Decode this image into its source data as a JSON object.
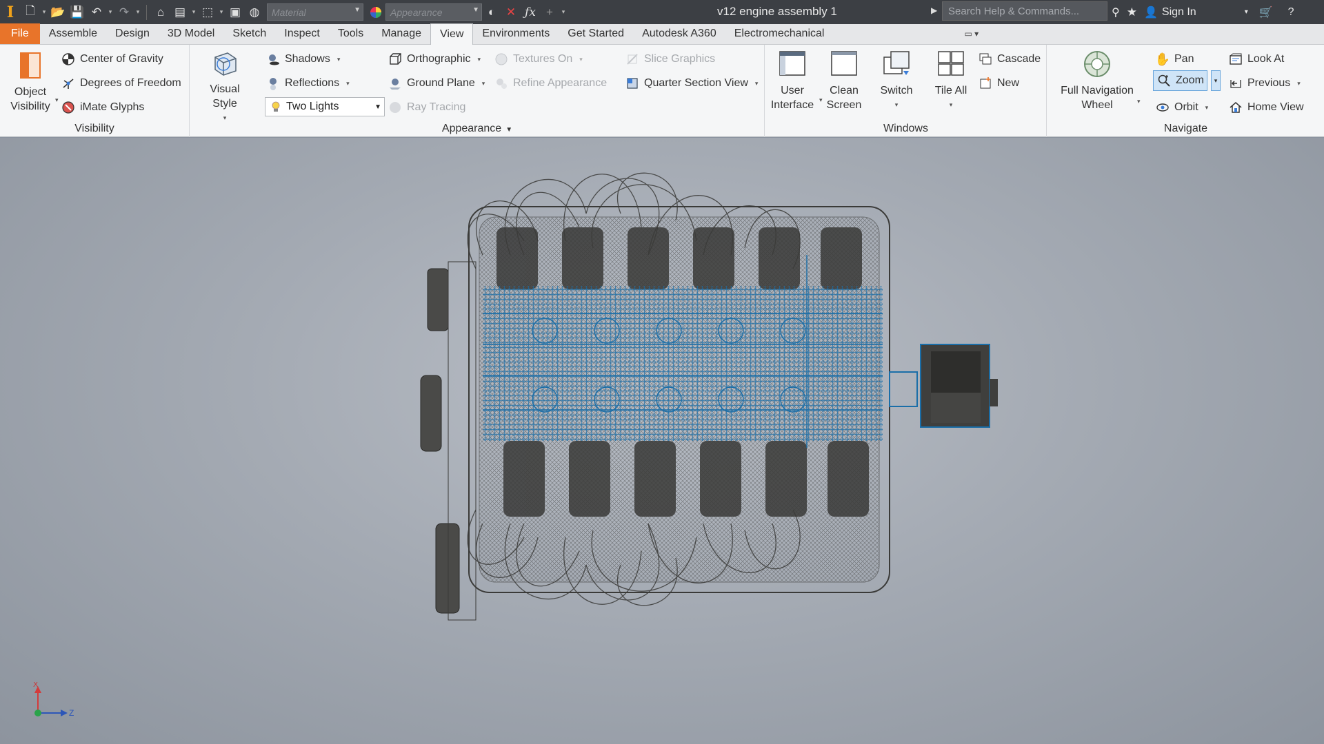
{
  "titlebar": {
    "doc_title": "v12 engine assembly 1",
    "material_placeholder": "Material",
    "appearance_placeholder": "Appearance",
    "search_placeholder": "Search Help & Commands...",
    "sign_in": "Sign In"
  },
  "tabs": [
    {
      "label": "File"
    },
    {
      "label": "Assemble"
    },
    {
      "label": "Design"
    },
    {
      "label": "3D Model"
    },
    {
      "label": "Sketch"
    },
    {
      "label": "Inspect"
    },
    {
      "label": "Tools"
    },
    {
      "label": "Manage"
    },
    {
      "label": "View"
    },
    {
      "label": "Environments"
    },
    {
      "label": "Get Started"
    },
    {
      "label": "Autodesk A360"
    },
    {
      "label": "Electromechanical"
    }
  ],
  "active_tab": "View",
  "ribbon": {
    "visibility": {
      "label": "Visibility",
      "object_visibility_1": "Object",
      "object_visibility_2": "Visibility",
      "center_of_gravity": "Center of Gravity",
      "degrees_of_freedom": "Degrees of Freedom",
      "imate_glyphs": "iMate Glyphs"
    },
    "appearance": {
      "label": "Appearance",
      "visual_style_1": "Visual Style",
      "shadows": "Shadows",
      "reflections": "Reflections",
      "lighting": "Two Lights",
      "orthographic": "Orthographic",
      "ground_plane": "Ground Plane",
      "ray_tracing": "Ray Tracing",
      "textures_on": "Textures On",
      "refine_appearance": "Refine Appearance",
      "slice_graphics": "Slice Graphics",
      "quarter_section": "Quarter Section View"
    },
    "windows": {
      "label": "Windows",
      "user_interface_1": "User",
      "user_interface_2": "Interface",
      "clean_screen_1": "Clean",
      "clean_screen_2": "Screen",
      "switch": "Switch",
      "tile_all": "Tile All",
      "cascade": "Cascade",
      "new": "New"
    },
    "navigate": {
      "label": "Navigate",
      "full_nav_1": "Full Navigation",
      "full_nav_2": "Wheel",
      "pan": "Pan",
      "zoom": "Zoom",
      "orbit": "Orbit",
      "look_at": "Look At",
      "previous": "Previous",
      "home_view": "Home View"
    }
  },
  "triad": {
    "x": "X",
    "z": "Z"
  },
  "colors": {
    "file_tab": "#e8742a",
    "titlebar": "#3c3f44",
    "wire_dark": "#3a3a38",
    "wire_blue": "#1a6ea8"
  }
}
